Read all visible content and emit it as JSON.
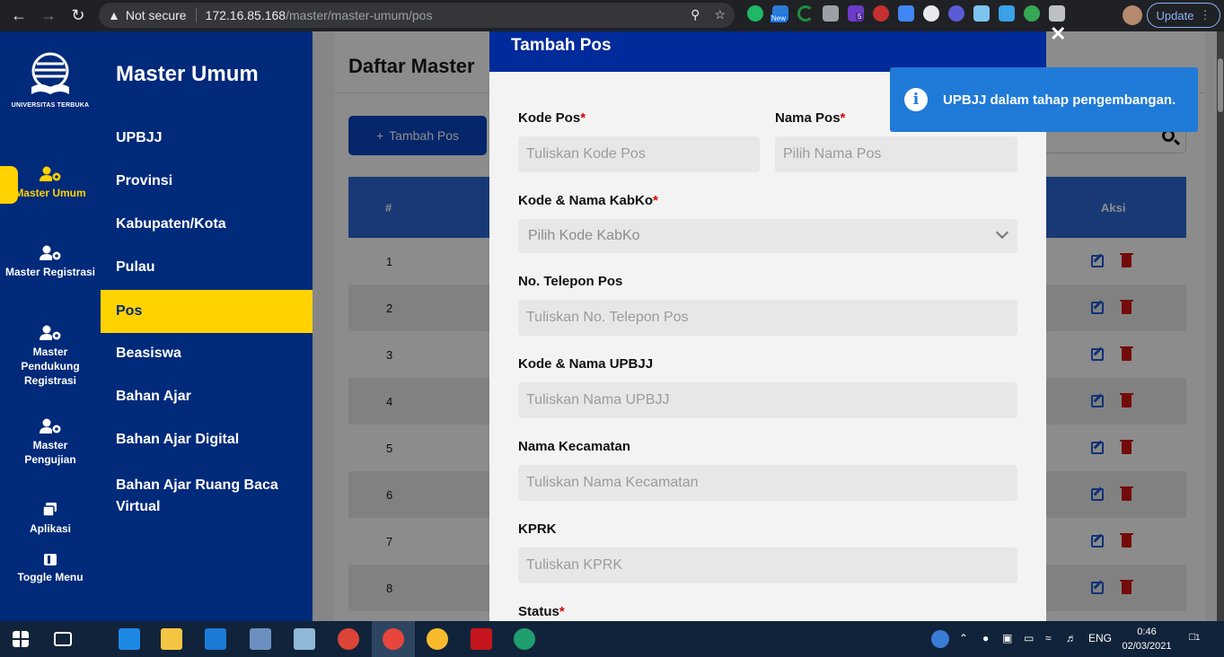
{
  "browser": {
    "security_label": "Not secure",
    "url_host": "172.16.85.168",
    "url_path": "/master/master-umum/pos",
    "update_label": "Update",
    "ext_badge_new": "New",
    "ext_badge_count": "5"
  },
  "rail": {
    "logo_caption": "UNIVERSITAS TERBUKA",
    "items": [
      {
        "label": "Master Umum"
      },
      {
        "label": "Master Registrasi"
      },
      {
        "label": "Master Pendukung Registrasi"
      },
      {
        "label": "Master Pengujian"
      },
      {
        "label": "Aplikasi"
      },
      {
        "label": "Toggle Menu"
      }
    ]
  },
  "menu": {
    "title": "Master Umum",
    "items": [
      {
        "label": "UPBJJ"
      },
      {
        "label": "Provinsi"
      },
      {
        "label": "Kabupaten/Kota"
      },
      {
        "label": "Pulau"
      },
      {
        "label": "Pos"
      },
      {
        "label": "Beasiswa"
      },
      {
        "label": "Bahan Ajar"
      },
      {
        "label": "Bahan Ajar Digital"
      },
      {
        "label": "Bahan Ajar Ruang Baca Virtual"
      }
    ],
    "active_index": 4
  },
  "page": {
    "title": "Daftar Master",
    "add_button": "Tambah Pos",
    "table": {
      "col_no": "#",
      "col_aksi": "Aksi",
      "rows": [
        "1",
        "2",
        "3",
        "4",
        "5",
        "6",
        "7",
        "8"
      ]
    }
  },
  "modal": {
    "title": "Tambah Pos",
    "fields": {
      "kode_pos": {
        "label": "Kode Pos",
        "required": "*",
        "placeholder": "Tuliskan Kode Pos"
      },
      "nama_pos": {
        "label": "Nama Pos",
        "required": "*",
        "placeholder": "Pilih Nama Pos"
      },
      "kabko": {
        "label": "Kode & Nama KabKo",
        "required": "*",
        "placeholder": "Pilih Kode KabKo"
      },
      "telepon": {
        "label": "No. Telepon Pos",
        "placeholder": "Tuliskan No. Telepon Pos"
      },
      "upbjj": {
        "label": "Kode & Nama UPBJJ",
        "placeholder": "Tuliskan Nama UPBJJ"
      },
      "kecamatan": {
        "label": "Nama Kecamatan",
        "placeholder": "Tuliskan Nama Kecamatan"
      },
      "kprk": {
        "label": "KPRK",
        "placeholder": "Tuliskan KPRK"
      },
      "status": {
        "label": "Status",
        "required": "*"
      }
    }
  },
  "toast": {
    "message": "UPBJJ dalam tahap pengembangan."
  },
  "taskbar": {
    "language": "ENG",
    "time": "0:46",
    "date": "02/03/2021",
    "notification_count": "1"
  },
  "colors": {
    "brand_navy": "#012a7a",
    "accent_yellow": "#ffd200",
    "primary_blue": "#0a46c4",
    "toast_blue": "#1f7ad8",
    "delete_red": "#d41414"
  }
}
